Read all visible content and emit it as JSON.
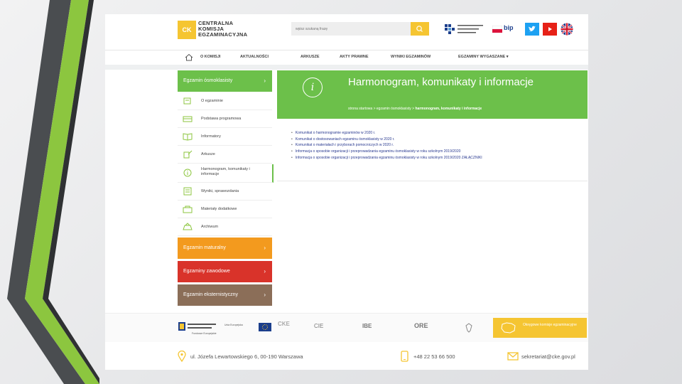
{
  "header": {
    "logo_badge": "CK",
    "logo_lines": [
      "CENTRALNA",
      "KOMISJA",
      "EGZAMINACYJNA"
    ],
    "search_placeholder": "wpisz szukaną frazę",
    "bip_label": "bip"
  },
  "nav": {
    "items": [
      "O KOMISJI",
      "AKTUALNOŚCI",
      "ARKUSZE",
      "AKTY PRAWNE",
      "WYNIKI EGZAMINÓW",
      "EGZAMINY WYGASZANE ▾"
    ]
  },
  "sidebar": {
    "top_section": {
      "label": "Egzamin ósmoklasisty",
      "color": "#6cc04a"
    },
    "items": [
      {
        "label": "O egzaminie",
        "icon": "exam-icon"
      },
      {
        "label": "Podstawa programowa",
        "icon": "curriculum-icon"
      },
      {
        "label": "Informatory",
        "icon": "book-icon"
      },
      {
        "label": "Arkusze",
        "icon": "sheet-icon"
      },
      {
        "label": "Harmonogram, komunikaty i informacje",
        "icon": "info-icon"
      },
      {
        "label": "Wyniki, sprawozdania",
        "icon": "results-icon"
      },
      {
        "label": "Materiały dodatkowe",
        "icon": "materials-icon"
      },
      {
        "label": "Archiwum",
        "icon": "archive-icon"
      }
    ],
    "sections": [
      {
        "label": "Egzamin maturalny",
        "color": "#f39a1e"
      },
      {
        "label": "Egzaminy zawodowe",
        "color": "#d9332a"
      },
      {
        "label": "Egzamin eksternistyczny",
        "color": "#8b6e58"
      }
    ]
  },
  "main": {
    "title": "Harmonogram, komunikaty i informacje",
    "breadcrumb_start": "strona startowa > egzamin ósmoklasisty >",
    "breadcrumb_current": "harmonogram, komunikaty i informacje",
    "links": [
      "Komunikat o harmonogramie egzaminów w 2020 r.",
      "Komunikat o dostosowaniach egzaminu ósmoklasisty w 2020 r.",
      "Komunikat o materiałach i przyborach pomocniczych w 2020 r.",
      "Informacja o sposobie organizacji i przeprowadzania egzaminu ósmoklasisty w roku szkolnym 2019/2020",
      "Informacja o sposobie organizacji i przeprowadzania egzaminu ósmoklasisty w roku szkolnym 2019/2020 ZAŁĄCZNIKI"
    ]
  },
  "footer": {
    "logos": [
      "Fundusze Europejskie",
      "Unia Europejska",
      "CKE",
      "CIE",
      "IBE",
      "ORE"
    ],
    "oke_label": "Okręgowe komisje egzaminacyjne",
    "address": "ul. Józefa Lewartowskiego 6, 00-190 Warszawa",
    "phone": "+48 22 53 66 500",
    "email": "sekretariat@cke.gov.pl"
  },
  "colors": {
    "green": "#6cc04a",
    "orange": "#f39a1e",
    "red": "#d9332a",
    "brown": "#8b6e58",
    "yellow": "#f5c532",
    "link_blue": "#2a3a90"
  }
}
